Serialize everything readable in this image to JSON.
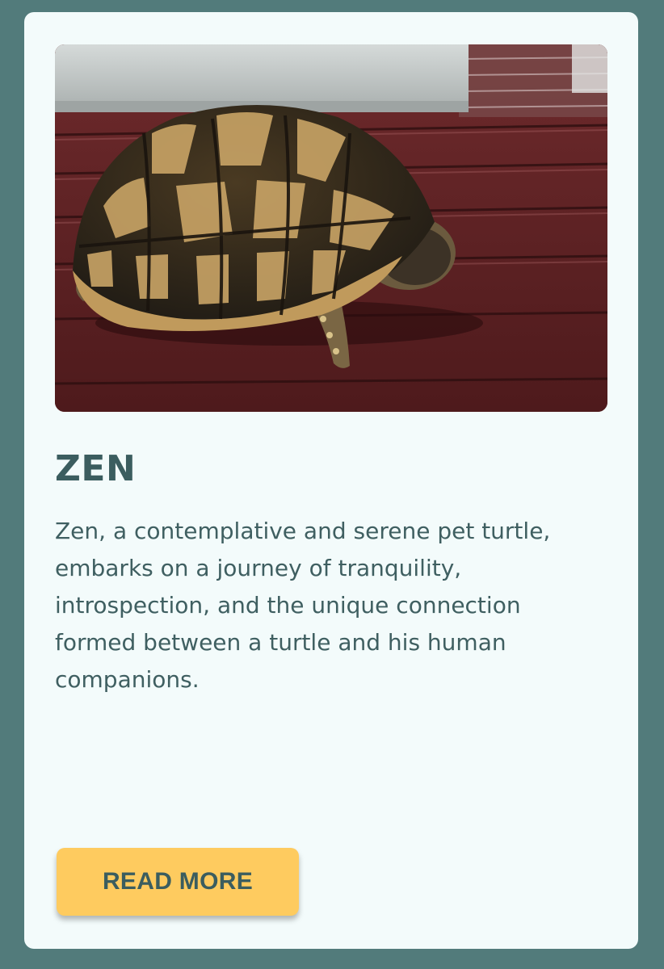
{
  "card": {
    "title": "ZEN",
    "description": "Zen, a contemplative and serene pet turtle, embarks on a journey of tranquility, introspection, and the unique connection formed between a turtle and his human companions.",
    "button_label": "READ MORE"
  },
  "colors": {
    "page_background": "#527b7b",
    "card_background": "#f3fbfb",
    "text": "#3b5d5f",
    "button": "#fecb5f"
  }
}
